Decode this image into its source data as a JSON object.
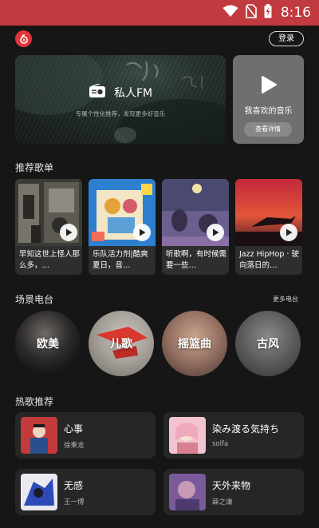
{
  "status_bar": {
    "time": "8:16",
    "icons": [
      "wifi-icon",
      "no-sim-icon",
      "battery-charging-icon"
    ]
  },
  "header": {
    "logo_icon": "netease-music-logo-icon",
    "login_label": "登录"
  },
  "banners": {
    "fm": {
      "title": "私人FM",
      "subtitle": "专属个性化推荐，发现更多好音乐",
      "icon": "radio-icon"
    },
    "favorites": {
      "title": "我喜欢的音乐",
      "button_label": "查看详情",
      "icon": "play-icon"
    }
  },
  "playlists": {
    "title": "推荐歌单",
    "items": [
      {
        "name": "早知这世上怪人那么多，…"
      },
      {
        "name": "乐队活力剂|酷爽夏日，音…"
      },
      {
        "name": "听歌啊，有时候需要一些…"
      },
      {
        "name": "Jazz HipHop · 驶向落日的…"
      }
    ]
  },
  "radios": {
    "title": "场景电台",
    "more_label": "更多电台",
    "items": [
      {
        "label": "欧美"
      },
      {
        "label": "儿歌"
      },
      {
        "label": "摇篮曲"
      },
      {
        "label": "古风"
      }
    ]
  },
  "hot_songs": {
    "title": "热歌推荐",
    "items": [
      {
        "title": "心事",
        "artist": "徐秉龙"
      },
      {
        "title": "染み渡る気持ち",
        "artist": "solfa"
      },
      {
        "title": "无感",
        "artist": "王一博"
      },
      {
        "title": "天外来物",
        "artist": "薛之谦"
      }
    ]
  },
  "colors": {
    "accent": "#c03a3f",
    "background": "#161616",
    "card": "#262626",
    "logo_red": "#e2353c"
  }
}
